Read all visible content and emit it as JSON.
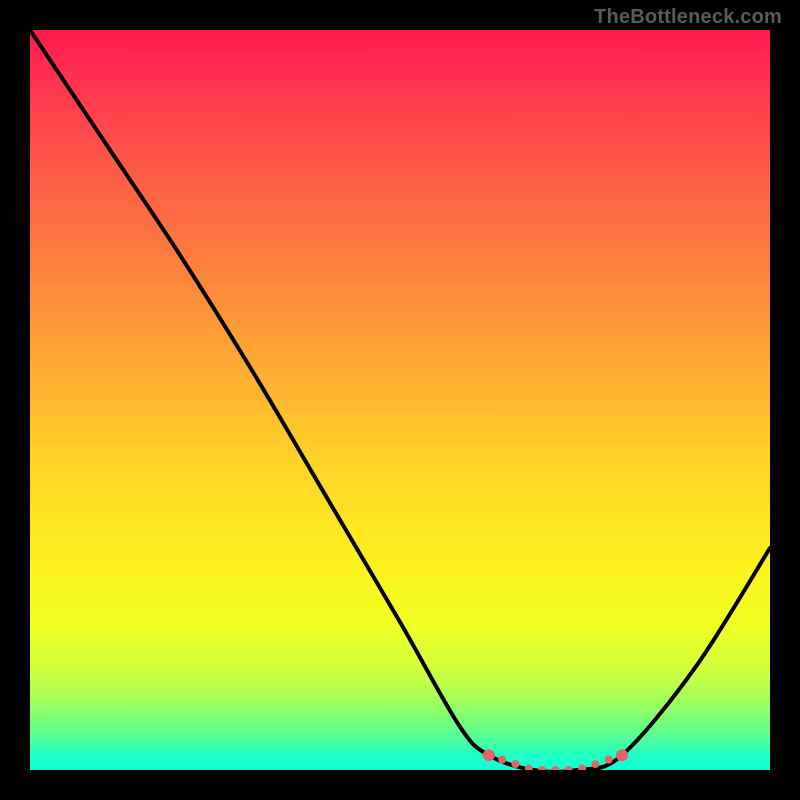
{
  "attribution": "TheBottleneck.com",
  "chart_data": {
    "type": "line",
    "title": "",
    "xlabel": "",
    "ylabel": "",
    "xlim": [
      0,
      100
    ],
    "ylim": [
      0,
      100
    ],
    "series": [
      {
        "name": "bottleneck-curve",
        "x": [
          0,
          10,
          20,
          30,
          40,
          50,
          58,
          62,
          68,
          74,
          80,
          90,
          100
        ],
        "values": [
          100,
          85,
          70,
          54,
          37,
          20,
          6,
          2,
          0,
          0,
          2,
          14,
          30
        ]
      }
    ],
    "annotations": [
      {
        "name": "optimal-region",
        "x_start": 62,
        "x_end": 80,
        "y": 2
      }
    ],
    "background": "spectrum-gradient"
  },
  "colors": {
    "frame": "#000000",
    "curve": "#000000",
    "optimal_marker": "#e06766",
    "attribution_text": "#5a5a5a"
  }
}
